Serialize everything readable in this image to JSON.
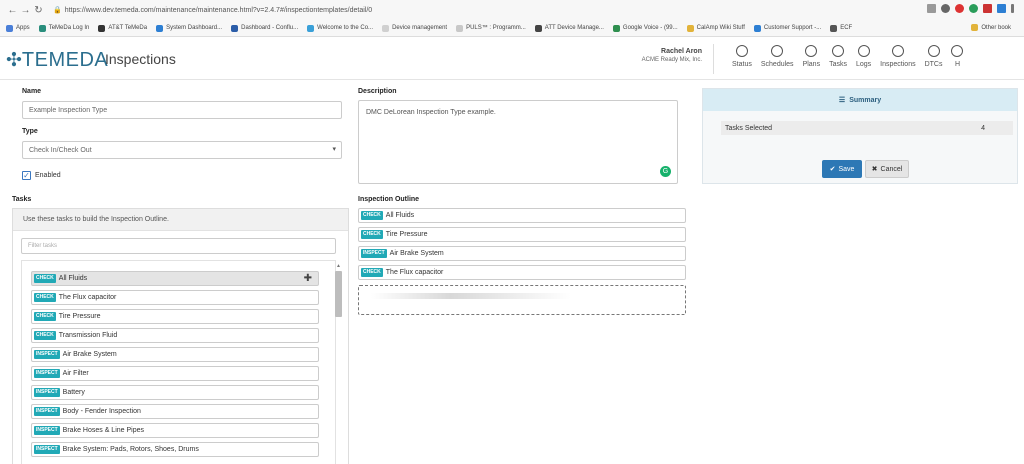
{
  "browser": {
    "url": "https://www.dev.temeda.com/maintenance/maintenance.html?v=2.4.7#/inspectiontemplates/detail/0",
    "bookmarks": [
      {
        "label": "Apps",
        "color": "#4a7fd8"
      },
      {
        "label": "TeMeDa Log In",
        "color": "#2a8e7d"
      },
      {
        "label": "AT&T TeMeDa",
        "color": "#333333"
      },
      {
        "label": "System Dashboard...",
        "color": "#2d7fd3"
      },
      {
        "label": "Dashboard - Conflu...",
        "color": "#2b5da8"
      },
      {
        "label": "Welcome to the Co...",
        "color": "#3aa0d8"
      },
      {
        "label": "Device management",
        "color": "#d0d0d0"
      },
      {
        "label": "PULS™ : Programm...",
        "color": "#c8c8c8"
      },
      {
        "label": "ATT Device Manage...",
        "color": "#444444"
      },
      {
        "label": "Google Voice - (99...",
        "color": "#2f8f4f"
      },
      {
        "label": "CalAmp Wiki Stuff",
        "color": "#e2b33a"
      },
      {
        "label": "Customer Support -...",
        "color": "#2d7fd3"
      },
      {
        "label": "ECF",
        "color": "#555555"
      }
    ],
    "other_bookmarks": "Other book"
  },
  "app": {
    "brand": "TEMEDA",
    "title": "Inspections",
    "user_name": "Rachel Aron",
    "user_org": "ACME Ready Mix, Inc.",
    "nav": [
      "Status",
      "Schedules",
      "Plans",
      "Tasks",
      "Logs",
      "Inspections",
      "DTCs",
      "H"
    ]
  },
  "form": {
    "name_label": "Name",
    "name_value": "Example Inspection Type",
    "type_label": "Type",
    "type_value": "Check In/Check Out",
    "enabled_label": "Enabled",
    "enabled": true,
    "description_label": "Description",
    "description_value": "DMC DeLorean Inspection Type example."
  },
  "summary": {
    "title": "Summary",
    "tasks_selected_label": "Tasks Selected",
    "tasks_selected_value": "4",
    "save_label": "Save",
    "cancel_label": "Cancel"
  },
  "tasks": {
    "label": "Tasks",
    "hint": "Use these tasks to build the Inspection Outline.",
    "filter_placeholder": "Filter tasks",
    "items": [
      {
        "badge": "CHECK",
        "label": "All Fluids"
      },
      {
        "badge": "CHECK",
        "label": "The Flux capacitor"
      },
      {
        "badge": "CHECK",
        "label": "Tire Pressure"
      },
      {
        "badge": "CHECK",
        "label": "Transmission Fluid"
      },
      {
        "badge": "INSPECT",
        "label": "Air Brake System"
      },
      {
        "badge": "INSPECT",
        "label": "Air Filter"
      },
      {
        "badge": "INSPECT",
        "label": "Battery"
      },
      {
        "badge": "INSPECT",
        "label": "Body - Fender Inspection"
      },
      {
        "badge": "INSPECT",
        "label": "Brake Hoses & Line Pipes"
      },
      {
        "badge": "INSPECT",
        "label": "Brake System: Pads, Rotors, Shoes, Drums"
      }
    ]
  },
  "outline": {
    "label": "Inspection Outline",
    "items": [
      {
        "badge": "CHECK",
        "label": "All Fluids"
      },
      {
        "badge": "CHECK",
        "label": "Tire Pressure"
      },
      {
        "badge": "INSPECT",
        "label": "Air Brake System"
      },
      {
        "badge": "CHECK",
        "label": "The Flux capacitor"
      }
    ]
  }
}
